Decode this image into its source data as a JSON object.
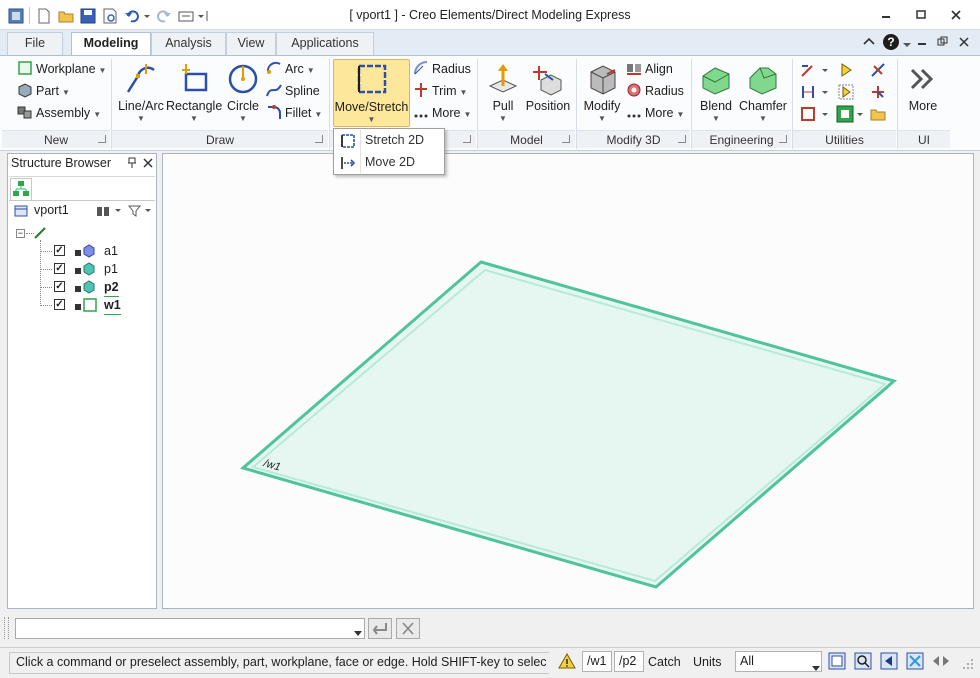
{
  "window": {
    "title": "[ vport1 ] - Creo Elements/Direct Modeling Express",
    "controls": [
      "minimize",
      "restore",
      "close"
    ]
  },
  "tabs": [
    "File",
    "Modeling",
    "Analysis",
    "View",
    "Applications"
  ],
  "active_tab": "Modeling",
  "ribbon": {
    "new": {
      "label": "New",
      "items": [
        "Workplane",
        "Part",
        "Assembly"
      ]
    },
    "draw": {
      "label": "Draw",
      "big": [
        "Line/Arc",
        "Rectangle",
        "Circle"
      ],
      "small": [
        "Arc",
        "Spline",
        "Fillet"
      ]
    },
    "edit": {
      "big": "Move/Stretch",
      "small": [
        "Radius",
        "Trim",
        "More"
      ]
    },
    "model": {
      "label": "Model",
      "big": [
        "Pull",
        "Position"
      ]
    },
    "modify3d": {
      "label": "Modify 3D",
      "big": "Modify",
      "small": [
        "Align",
        "Radius",
        "More"
      ]
    },
    "engineering": {
      "label": "Engineering",
      "big": [
        "Blend",
        "Chamfer"
      ]
    },
    "utilities": {
      "label": "Utilities"
    },
    "ui": {
      "label": "UI",
      "big": "More"
    }
  },
  "dropdown": {
    "items": [
      "Stretch 2D",
      "Move 2D"
    ]
  },
  "structure_browser": {
    "title": "Structure Browser",
    "root": "vport1",
    "items": [
      {
        "label": "a1",
        "checked": true,
        "bold": false
      },
      {
        "label": "p1",
        "checked": true,
        "bold": false
      },
      {
        "label": "p2",
        "checked": true,
        "bold": true
      },
      {
        "label": "w1",
        "checked": true,
        "bold": true
      }
    ]
  },
  "viewport": {
    "workplane_label": "/w1",
    "plane_color": "#4fc39a"
  },
  "status": {
    "message": "Click a command or preselect assembly, part, workplane, face or edge. Hold SHIFT-key to select m...",
    "workplane": "/w1",
    "part": "/p2",
    "catch": "Catch",
    "units": "Units",
    "filter": "All"
  }
}
